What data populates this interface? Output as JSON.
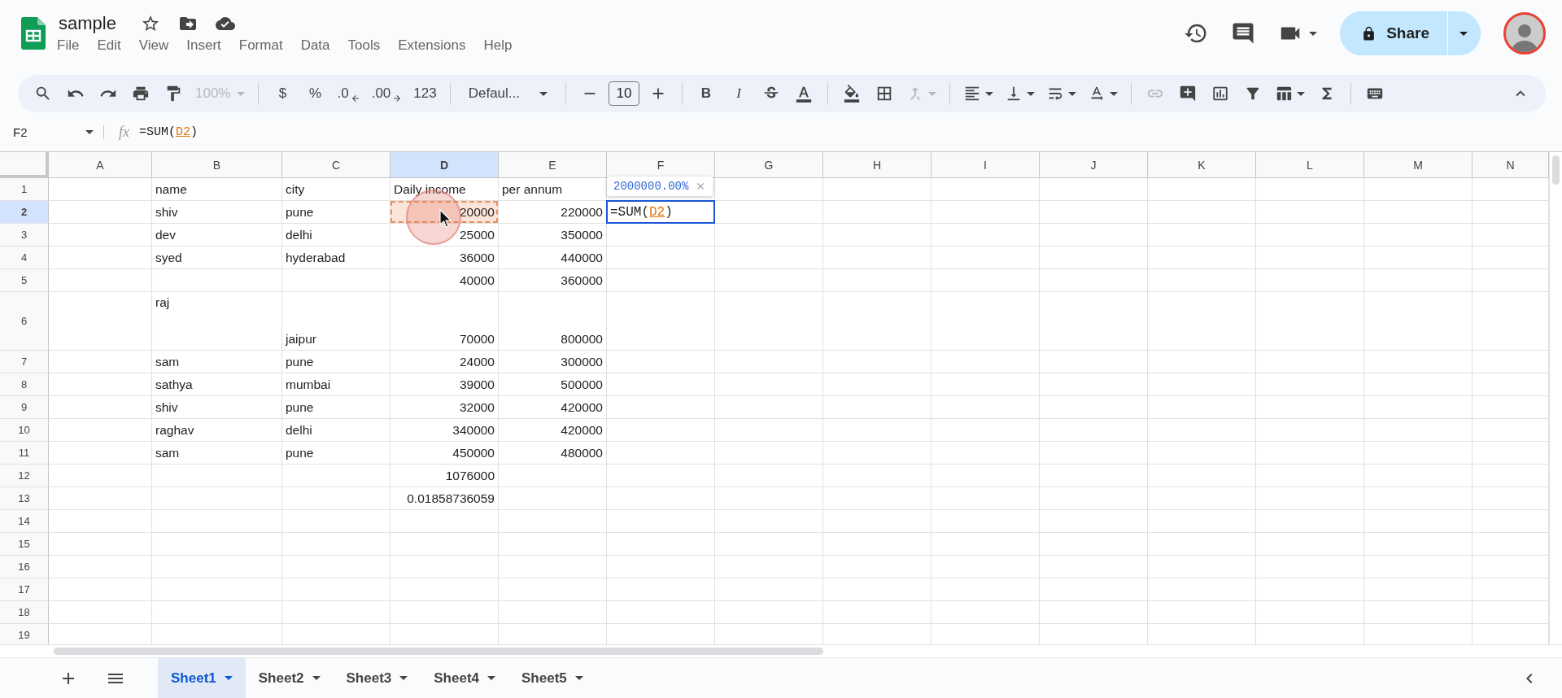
{
  "document": {
    "title": "sample"
  },
  "menu": [
    "File",
    "Edit",
    "View",
    "Insert",
    "Format",
    "Data",
    "Tools",
    "Extensions",
    "Help"
  ],
  "share": {
    "label": "Share"
  },
  "toolbar": {
    "zoom": "100%",
    "currency": "$",
    "percent": "%",
    "decrease_decimals": ".0",
    "increase_decimals": ".00",
    "number_format": "123",
    "font": "Defaul...",
    "font_size": "10",
    "bold": "B",
    "italic": "I"
  },
  "formula_bar": {
    "cell": "F2",
    "fx": "fx",
    "prefix": "=SUM(",
    "ref": "D2",
    "suffix": ")"
  },
  "columns": [
    {
      "label": "A",
      "selected": false
    },
    {
      "label": "B",
      "selected": false
    },
    {
      "label": "C",
      "selected": false
    },
    {
      "label": "D",
      "selected": true
    },
    {
      "label": "E",
      "selected": false
    },
    {
      "label": "F",
      "selected": false
    },
    {
      "label": "G",
      "selected": false
    },
    {
      "label": "H",
      "selected": false
    },
    {
      "label": "I",
      "selected": false
    },
    {
      "label": "J",
      "selected": false
    },
    {
      "label": "K",
      "selected": false
    },
    {
      "label": "L",
      "selected": false
    },
    {
      "label": "M",
      "selected": false
    },
    {
      "label": "N",
      "selected": false
    }
  ],
  "rows": [
    {
      "number": "1",
      "selected": false,
      "tall": false,
      "cells": [
        null,
        {
          "kind": "text",
          "text": "name"
        },
        {
          "kind": "text",
          "text": "city"
        },
        {
          "kind": "text",
          "text": "Daily income"
        },
        {
          "kind": "text",
          "text": "per annum"
        }
      ]
    },
    {
      "number": "2",
      "selected": true,
      "tall": false,
      "cells": [
        null,
        {
          "kind": "text",
          "text": "shiv"
        },
        {
          "kind": "text",
          "text": "pune"
        },
        {
          "kind": "reference",
          "text": "20000"
        },
        {
          "kind": "number",
          "text": "220000"
        },
        {
          "kind": "editing",
          "prefix": "=SUM(",
          "ref": "D2",
          "suffix": ")",
          "hint": "2000000.00%"
        }
      ]
    },
    {
      "number": "3",
      "selected": false,
      "tall": false,
      "cells": [
        null,
        {
          "kind": "text",
          "text": "dev"
        },
        {
          "kind": "text",
          "text": "delhi"
        },
        {
          "kind": "number",
          "text": "25000"
        },
        {
          "kind": "number",
          "text": "350000"
        }
      ]
    },
    {
      "number": "4",
      "selected": false,
      "tall": false,
      "cells": [
        null,
        {
          "kind": "text",
          "text": "syed"
        },
        {
          "kind": "text",
          "text": "hyderabad"
        },
        {
          "kind": "number",
          "text": "36000"
        },
        {
          "kind": "number",
          "text": "440000"
        }
      ]
    },
    {
      "number": "5",
      "selected": false,
      "tall": false,
      "cells": [
        null,
        null,
        null,
        {
          "kind": "number",
          "text": "40000"
        },
        {
          "kind": "number",
          "text": "360000"
        }
      ]
    },
    {
      "number": "6",
      "selected": false,
      "tall": true,
      "cells": [
        null,
        {
          "kind": "top",
          "text": "raj"
        },
        {
          "kind": "text",
          "text": "jaipur"
        },
        {
          "kind": "number",
          "text": "70000"
        },
        {
          "kind": "number",
          "text": "800000"
        }
      ]
    },
    {
      "number": "7",
      "selected": false,
      "tall": false,
      "cells": [
        null,
        {
          "kind": "text",
          "text": "sam"
        },
        {
          "kind": "text",
          "text": "pune"
        },
        {
          "kind": "number",
          "text": "24000"
        },
        {
          "kind": "number",
          "text": "300000"
        }
      ]
    },
    {
      "number": "8",
      "selected": false,
      "tall": false,
      "cells": [
        null,
        {
          "kind": "text",
          "text": "sathya"
        },
        {
          "kind": "text",
          "text": "mumbai"
        },
        {
          "kind": "number",
          "text": "39000"
        },
        {
          "kind": "number",
          "text": "500000"
        }
      ]
    },
    {
      "number": "9",
      "selected": false,
      "tall": false,
      "cells": [
        null,
        {
          "kind": "text",
          "text": "shiv"
        },
        {
          "kind": "text",
          "text": "pune"
        },
        {
          "kind": "number",
          "text": "32000"
        },
        {
          "kind": "number",
          "text": "420000"
        }
      ]
    },
    {
      "number": "10",
      "selected": false,
      "tall": false,
      "cells": [
        null,
        {
          "kind": "text",
          "text": "raghav"
        },
        {
          "kind": "text",
          "text": "delhi"
        },
        {
          "kind": "number",
          "text": "340000"
        },
        {
          "kind": "number",
          "text": "420000"
        }
      ]
    },
    {
      "number": "11",
      "selected": false,
      "tall": false,
      "cells": [
        null,
        {
          "kind": "text",
          "text": "sam"
        },
        {
          "kind": "text",
          "text": "pune"
        },
        {
          "kind": "number",
          "text": "450000"
        },
        {
          "kind": "number",
          "text": "480000"
        }
      ]
    },
    {
      "number": "12",
      "selected": false,
      "tall": false,
      "cells": [
        null,
        null,
        null,
        {
          "kind": "number",
          "text": "1076000"
        }
      ]
    },
    {
      "number": "13",
      "selected": false,
      "tall": false,
      "cells": [
        null,
        null,
        null,
        {
          "kind": "number",
          "text": "0.01858736059"
        }
      ]
    },
    {
      "number": "14",
      "selected": false,
      "tall": false,
      "cells": []
    },
    {
      "number": "15",
      "selected": false,
      "tall": false,
      "cells": []
    },
    {
      "number": "16",
      "selected": false,
      "tall": false,
      "cells": []
    },
    {
      "number": "17",
      "selected": false,
      "tall": false,
      "cells": []
    },
    {
      "number": "18",
      "selected": false,
      "tall": false,
      "cells": []
    },
    {
      "number": "19",
      "selected": false,
      "tall": false,
      "cells": []
    }
  ],
  "sheets": [
    {
      "label": "Sheet1",
      "selected": true
    },
    {
      "label": "Sheet2",
      "selected": false
    },
    {
      "label": "Sheet3",
      "selected": false
    },
    {
      "label": "Sheet4",
      "selected": false
    },
    {
      "label": "Sheet5",
      "selected": false
    }
  ]
}
